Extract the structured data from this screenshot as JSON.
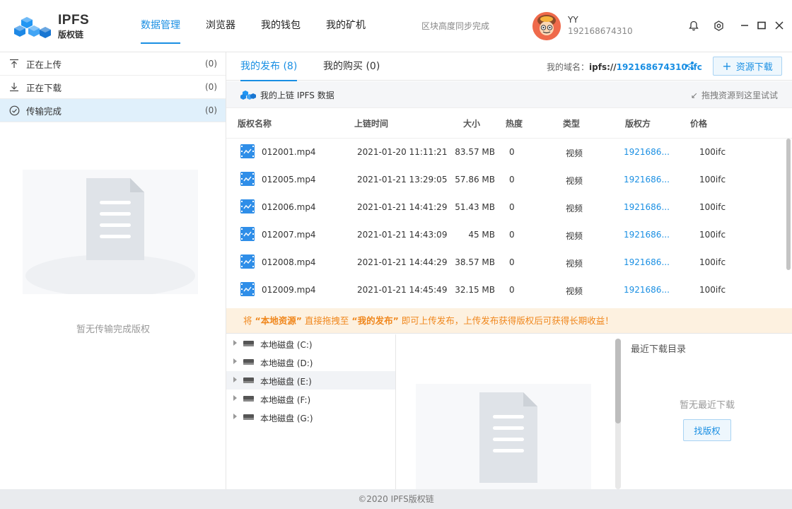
{
  "app": {
    "title": "IPFS",
    "subtitle": "版权链",
    "sync_status": "区块高度同步完成",
    "footer": "©2020 IPFS版权链"
  },
  "nav": [
    {
      "label": "数据管理",
      "active": true
    },
    {
      "label": "浏览器",
      "active": false
    },
    {
      "label": "我的钱包",
      "active": false
    },
    {
      "label": "我的矿机",
      "active": false
    }
  ],
  "user": {
    "name": "YY",
    "id": "192168674310"
  },
  "header_icons": [
    "bell-icon",
    "settings-icon",
    "minimize-icon",
    "maximize-icon",
    "close-icon"
  ],
  "transfers": [
    {
      "label": "正在上传",
      "count": "(0)",
      "icon": "upload-icon"
    },
    {
      "label": "正在下载",
      "count": "(0)",
      "icon": "download-icon"
    },
    {
      "label": "传输完成",
      "count": "(0)",
      "icon": "check-circle-icon",
      "active": true
    }
  ],
  "left_empty_text": "暂无传输完成版权",
  "tabs": [
    {
      "label": "我的发布 (8)",
      "active": true
    },
    {
      "label": "我的购买 (0)",
      "active": false
    }
  ],
  "domain": {
    "label": "我的域名：",
    "prefix": "ipfs://",
    "value": "192168674310.ifc"
  },
  "resource_download_label": "资源下载",
  "subbar": {
    "title": "我的上链 IPFS 数据",
    "hint": "拖拽资源到这里试试"
  },
  "table": {
    "columns": [
      "版权名称",
      "上链时间",
      "大小",
      "热度",
      "类型",
      "版权方",
      "价格"
    ],
    "rows": [
      {
        "name": "012001.mp4",
        "time": "2021-01-20 11:11:21",
        "size": "83.57 MB",
        "heat": "0",
        "type": "视频",
        "owner": "1921686...",
        "price": "100ifc"
      },
      {
        "name": "012005.mp4",
        "time": "2021-01-21 13:29:05",
        "size": "57.86 MB",
        "heat": "0",
        "type": "视频",
        "owner": "1921686...",
        "price": "100ifc"
      },
      {
        "name": "012006.mp4",
        "time": "2021-01-21 14:41:29",
        "size": "51.43 MB",
        "heat": "0",
        "type": "视频",
        "owner": "1921686...",
        "price": "100ifc"
      },
      {
        "name": "012007.mp4",
        "time": "2021-01-21 14:43:09",
        "size": "45 MB",
        "heat": "0",
        "type": "视频",
        "owner": "1921686...",
        "price": "100ifc"
      },
      {
        "name": "012008.mp4",
        "time": "2021-01-21 14:44:29",
        "size": "38.57 MB",
        "heat": "0",
        "type": "视频",
        "owner": "1921686...",
        "price": "100ifc"
      },
      {
        "name": "012009.mp4",
        "time": "2021-01-21 14:45:49",
        "size": "32.15 MB",
        "heat": "0",
        "type": "视频",
        "owner": "1921686...",
        "price": "100ifc"
      }
    ]
  },
  "notice": {
    "p1": "将 ",
    "b1": "“本地资源”",
    "p2": " 直接拖拽至 ",
    "b2": "“我的发布”",
    "p3": " 即可上传发布，上传发布获得版权后可获得长期收益！"
  },
  "disks": [
    {
      "label": "本地磁盘 (C:)"
    },
    {
      "label": "本地磁盘 (D:)"
    },
    {
      "label": "本地磁盘 (E:)",
      "hover": true
    },
    {
      "label": "本地磁盘 (F:)"
    },
    {
      "label": "本地磁盘 (G:)"
    }
  ],
  "recent": {
    "title": "最近下载目录",
    "empty": "暂无最近下载",
    "button": "找版权"
  },
  "colors": {
    "accent": "#1a8fe3",
    "notice_text": "#f0871d",
    "notice_bg": "#fdf1e0"
  }
}
